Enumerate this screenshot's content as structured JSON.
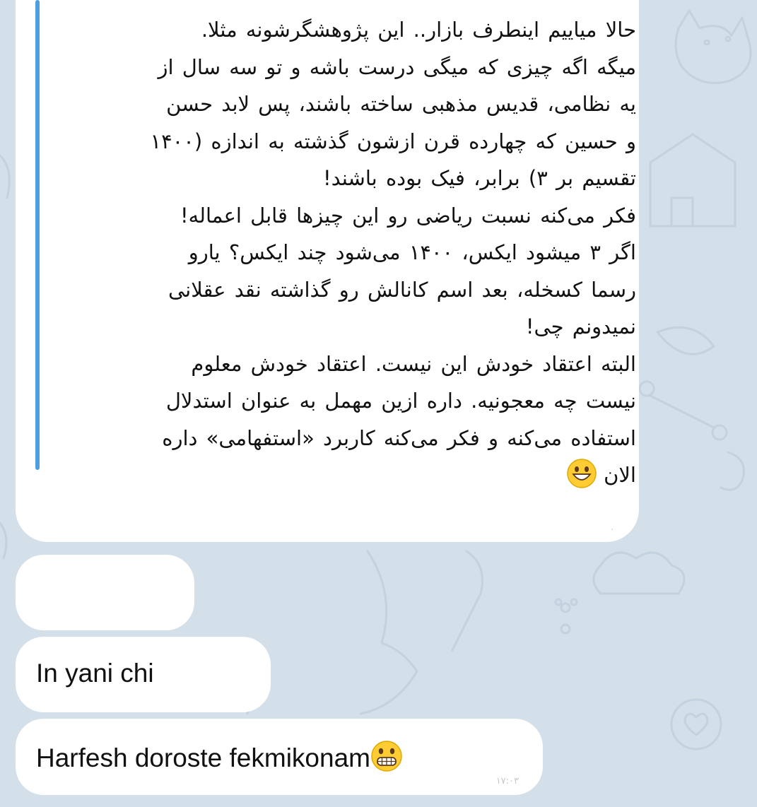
{
  "forwarded_message": {
    "lines": [
      "حالا میاییم اینطرف بازار.. این پژوهشگرشونه مثلا.",
      "میگه اگه چیزی که میگی درست باشه و تو سه سال از",
      "یه نظامی، قدیس مذهبی ساخته باشند، پس لابد حسن",
      "و حسین که چهارده قرن ازشون گذشته به اندازه (۱۴۰۰",
      "تقسیم بر ۳) برابر، فیک بوده باشند!",
      "فکر می‌کنه نسبت ریاضی رو این چیزها قابل اعماله!",
      "اگر ۳ میشود ایکس، ۱۴۰۰ می‌شود چند ایکس؟ یارو",
      "رسما کسخله، بعد اسم کانالش رو گذاشته نقد عقلانی",
      "نمیدونم چی!",
      "البته اعتقاد خودش این نیست. اعتقاد خودش معلوم",
      "نیست چه معجونیه. داره ازین مهمل به عنوان استدلال",
      "استفاده می‌کنه و فکر می‌کنه کاربرد «استفهامی» داره"
    ],
    "last_line_text": "الان",
    "last_line_emoji": "grinning-face-emoji",
    "time": "."
  },
  "messages": [
    {
      "text": "",
      "time": ""
    },
    {
      "text": "In yani chi",
      "time": ""
    },
    {
      "text": "Harfesh doroste fekmikonam",
      "emoji": "grimacing-face-emoji",
      "time": "۱۷:۰۳"
    }
  ],
  "colors": {
    "background": "#d3dfe9",
    "bubble": "#ffffff",
    "quote_accent": "#4f9fe0",
    "text": "#111111"
  }
}
